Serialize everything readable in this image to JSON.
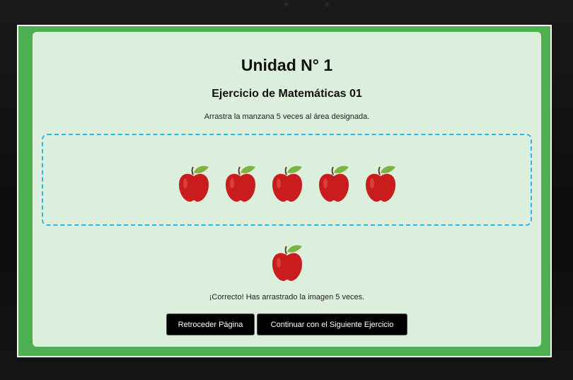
{
  "header": {
    "unit_title": "Unidad N° 1",
    "exercise_title": "Ejercicio de Matemáticas 01",
    "instructions": "Arrastra la manzana 5 veces al área designada."
  },
  "drop_zone": {
    "apple_count": 5,
    "border_color": "#29b6e8"
  },
  "source_apple": {
    "icon": "apple-icon"
  },
  "feedback": {
    "message": "¡Correcto! Has arrastrado la imagen 5 veces."
  },
  "buttons": {
    "back_label": "Retroceder Página",
    "next_label": "Continuar con el Siguiente Ejercicio"
  },
  "colors": {
    "frame": "#4caf50",
    "card": "#dcefdc",
    "apple": "#c91d1d",
    "leaf": "#7cb342",
    "button": "#000000"
  }
}
